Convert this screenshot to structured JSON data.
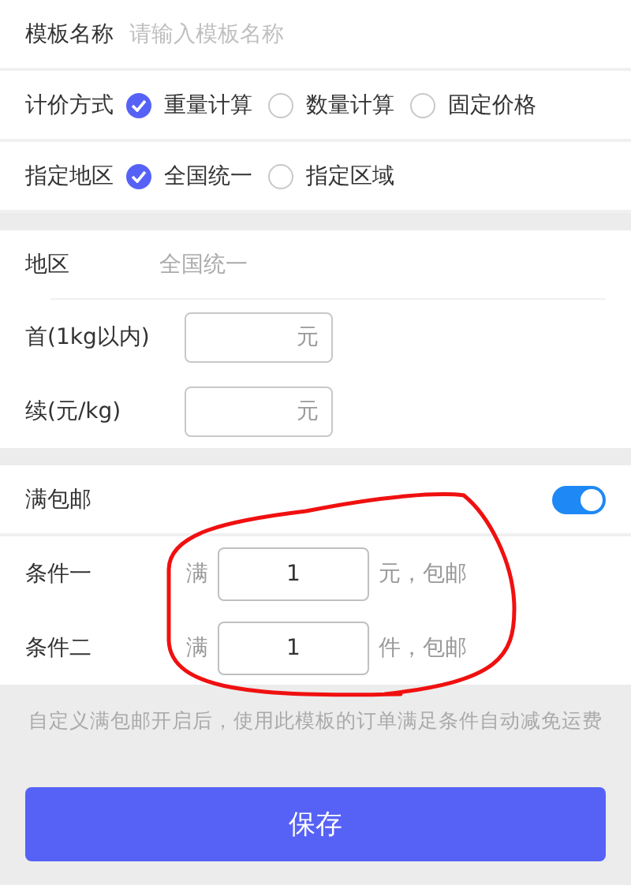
{
  "template_name": {
    "label": "模板名称",
    "placeholder": "请输入模板名称"
  },
  "pricing": {
    "label": "计价方式",
    "options": [
      {
        "label": "重量计算",
        "selected": true
      },
      {
        "label": "数量计算",
        "selected": false
      },
      {
        "label": "固定价格",
        "selected": false
      }
    ]
  },
  "region_mode": {
    "label": "指定地区",
    "options": [
      {
        "label": "全国统一",
        "selected": true
      },
      {
        "label": "指定区域",
        "selected": false
      }
    ]
  },
  "region": {
    "label": "地区",
    "value": "全国统一"
  },
  "fees": [
    {
      "label": "首(1kg以内)",
      "unit": "元"
    },
    {
      "label": "续(元/kg)",
      "unit": "元"
    }
  ],
  "free_shipping": {
    "label": "满包邮",
    "on": true,
    "conditions": [
      {
        "label": "条件一",
        "prefix": "满",
        "value": "1",
        "suffix": "元，包邮"
      },
      {
        "label": "条件二",
        "prefix": "满",
        "value": "1",
        "suffix": "件，包邮"
      }
    ],
    "note": "自定义满包邮开启后，使用此模板的订单满足条件自动减免运费"
  },
  "save_button": "保存"
}
